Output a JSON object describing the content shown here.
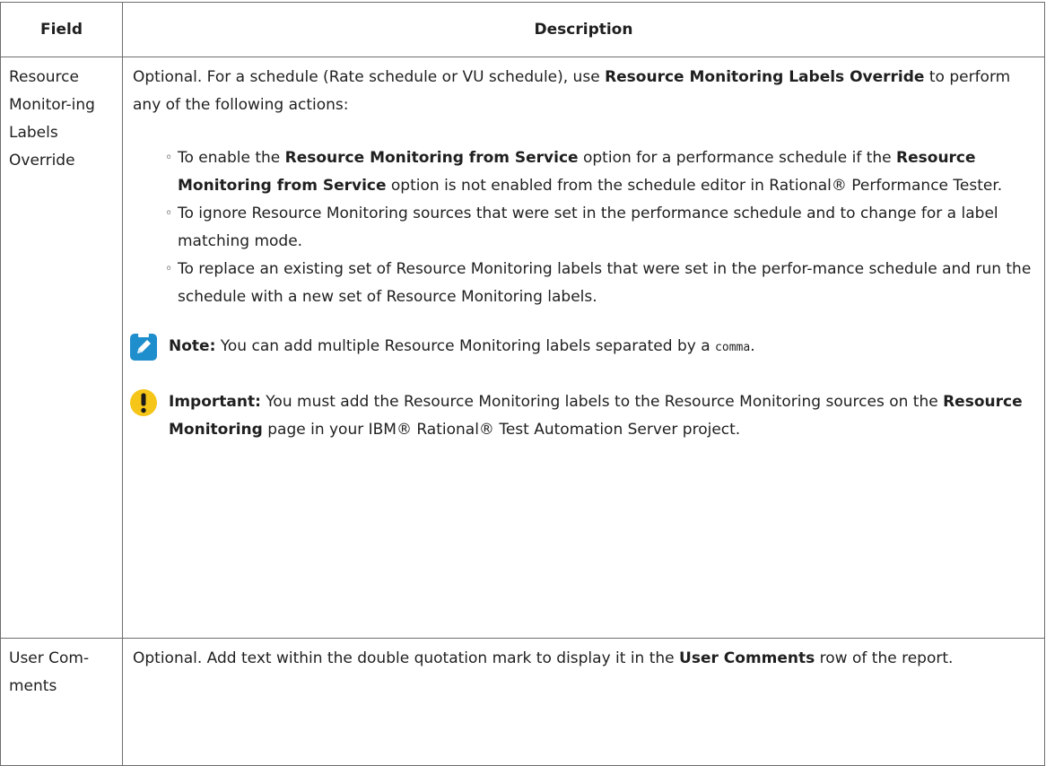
{
  "table": {
    "headers": {
      "field": "Field",
      "description": "Description"
    },
    "rows": [
      {
        "field": "Resource Monitor-ing Labels Override",
        "intro": {
          "t1": "Optional. For a schedule (Rate schedule or VU schedule), use ",
          "b1": "Resource Monitoring Labels Override",
          "t2": " to perform any of the following actions:"
        },
        "bullet_glyph": "◦",
        "actions": [
          {
            "t1": "To enable the ",
            "b1": "Resource Monitoring from Service",
            "t2": " option for a performance schedule if the ",
            "b2": "Resource Monitoring from Service",
            "t3": " option is not enabled from the schedule editor in Rational® Performance Tester."
          },
          {
            "text": "To ignore Resource Monitoring sources that were set in the performance schedule and to change for a label matching mode."
          },
          {
            "text": "To replace an existing set of Resource Monitoring labels that were set in the perfor-mance schedule and run the schedule with a new set of Resource Monitoring labels."
          }
        ],
        "note": {
          "icon": "pencil-icon",
          "color": "#1f8ecd",
          "label": "Note:",
          "t1": " You can add multiple Resource Monitoring labels separated by a ",
          "code": "comma",
          "t2": "."
        },
        "important": {
          "icon": "exclamation-icon",
          "color": "#f5c518",
          "label": "Important:",
          "t1": " You must add the Resource Monitoring labels to the Resource Monitoring sources on the ",
          "b1": "Resource Monitoring",
          "t2": " page in your IBM® Rational® Test Automation Server project."
        }
      },
      {
        "field": "User Com-ments",
        "t1": "Optional. Add text within the double quotation mark to display it in the ",
        "b1": "User Comments",
        "t2": " row of the report."
      }
    ]
  }
}
